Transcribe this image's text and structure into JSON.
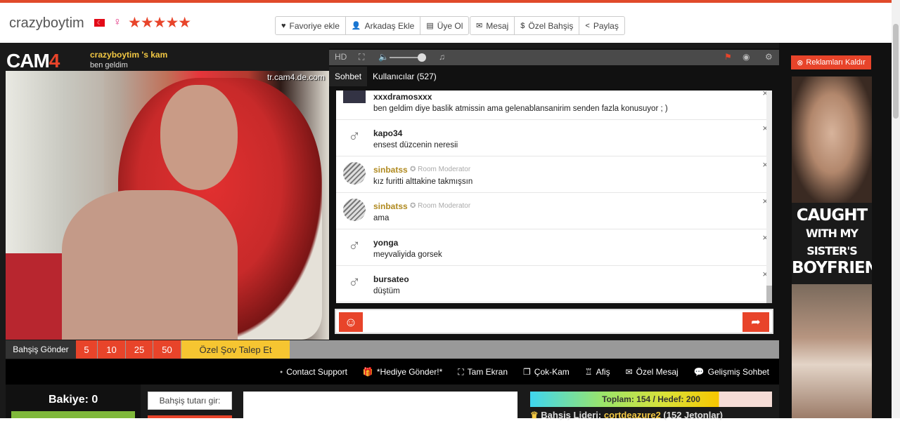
{
  "header": {
    "username": "crazyboytim",
    "flag_icon": "turkey-flag-icon",
    "gender_symbol": "♀",
    "rating_stars": "★★★★★",
    "buttons_left": [
      {
        "icon": "♥",
        "label": "Favoriye ekle"
      },
      {
        "icon": "👤",
        "label": "Arkadaş Ekle"
      },
      {
        "icon": "▤",
        "label": "Üye Ol"
      }
    ],
    "buttons_right": [
      {
        "icon": "✉",
        "label": "Mesaj"
      },
      {
        "icon": "$",
        "label": "Özel Bahşiş"
      },
      {
        "icon": "<",
        "label": "Paylaş"
      }
    ]
  },
  "player": {
    "logo_main": "CAM",
    "logo_num": "4",
    "kam_title": "crazyboytim 's kam",
    "kam_subtitle": "ben geldim",
    "watermark": "tr.cam4.de.com"
  },
  "tip_bar": {
    "label": "Bahşiş Gönder",
    "amounts": [
      "5",
      "10",
      "25",
      "50"
    ],
    "private_show": "Özel Şov Talep Et"
  },
  "chat": {
    "toolbar": {
      "hd": "HD"
    },
    "tabs": [
      {
        "label": "Sohbet"
      },
      {
        "label": "Kullanıcılar (527)"
      }
    ],
    "messages": [
      {
        "user": "xxxdramosxxx",
        "text": "ben geldim diye baslik atmissin ama gelenablansanirim senden fazla konusuyor ; )",
        "avatar": "custom"
      },
      {
        "user": "kapo34",
        "text": "ensest düzcenin neresii",
        "avatar": "user"
      },
      {
        "user": "sinbatss",
        "badge": "Room Moderator",
        "text": "kız furitti alttakine takmışsın",
        "avatar": "tiger"
      },
      {
        "user": "sinbatss",
        "badge": "Room Moderator",
        "text": "ama",
        "avatar": "tiger"
      },
      {
        "user": "yonga",
        "text": "meyvaliyida gorsek",
        "avatar": "user"
      },
      {
        "user": "bursateo",
        "text": "düştüm",
        "avatar": "user"
      }
    ],
    "close_symbol": "×"
  },
  "links": [
    {
      "icon": "●",
      "label": "Contact Support"
    },
    {
      "icon": "🎁",
      "label": "*Hediye Gönder!*"
    },
    {
      "icon": "⛶",
      "label": "Tam Ekran"
    },
    {
      "icon": "❐",
      "label": "Çok-Kam"
    },
    {
      "icon": "♖",
      "label": "Afiş"
    },
    {
      "icon": "✉",
      "label": "Özel Mesaj"
    },
    {
      "icon": "💬",
      "label": "Gelişmiş Sohbet"
    }
  ],
  "bottom": {
    "balance": "Bakiye: 0",
    "tip_amount_label": "Bahşiş tutarı gir:",
    "goal_text": "Toplam: 154 / Hedef: 200",
    "goal_progress": 0.77,
    "leader_label": "Bahşiş Lideri:",
    "leader_name": "cortdeazure2",
    "leader_tokens": "(152 Jetonlar)"
  },
  "ad": {
    "remove_label": "Reklamları Kaldır",
    "title_lines": [
      "CAUGHT",
      "WITH MY SISTER'S",
      "BOYFRIEND"
    ]
  },
  "colors": {
    "accent": "#e8442a",
    "gold": "#f3c843",
    "private_show": "#f6c531"
  }
}
